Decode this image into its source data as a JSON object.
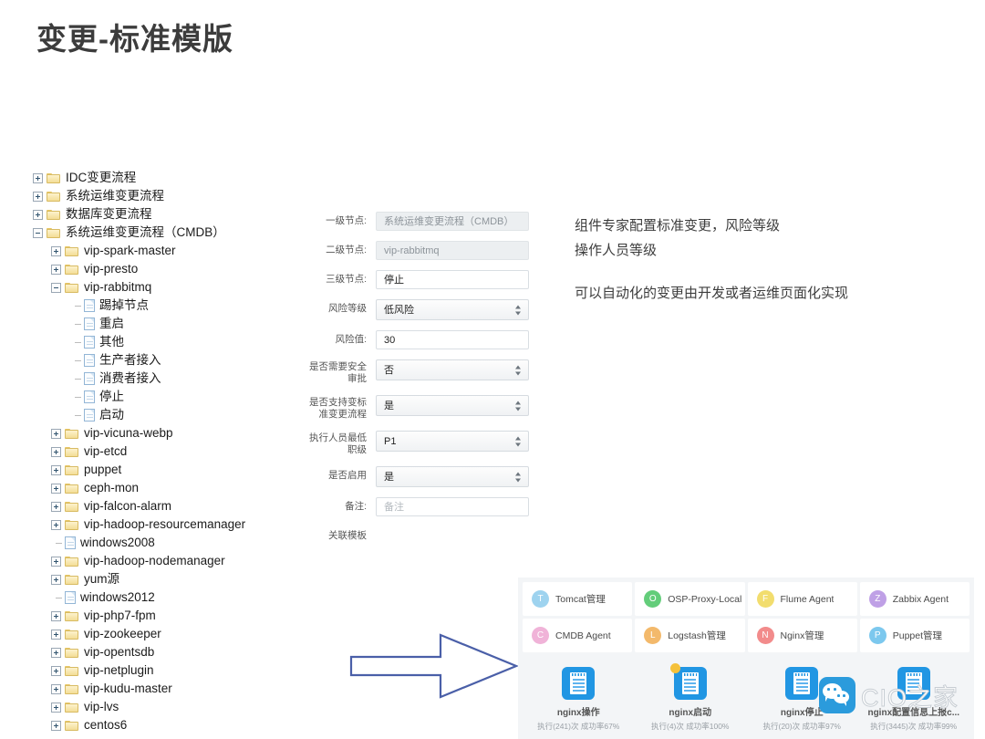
{
  "title": "变更-标准模版",
  "tree": {
    "nodes": [
      {
        "label": "IDC变更流程",
        "level": 1,
        "type": "folder",
        "state": "collapsed"
      },
      {
        "label": "系统运维变更流程",
        "level": 1,
        "type": "folder",
        "state": "collapsed"
      },
      {
        "label": "数据库变更流程",
        "level": 1,
        "type": "folder",
        "state": "collapsed"
      },
      {
        "label": "系统运维变更流程（CMDB）",
        "level": 1,
        "type": "folder",
        "state": "expanded"
      },
      {
        "label": "vip-spark-master",
        "level": 2,
        "type": "folder",
        "state": "collapsed"
      },
      {
        "label": "vip-presto",
        "level": 2,
        "type": "folder",
        "state": "collapsed"
      },
      {
        "label": "vip-rabbitmq",
        "level": 2,
        "type": "folder",
        "state": "expanded"
      },
      {
        "label": "踢掉节点",
        "level": 3,
        "type": "file",
        "state": "leaf"
      },
      {
        "label": "重启",
        "level": 3,
        "type": "file",
        "state": "leaf"
      },
      {
        "label": "其他",
        "level": 3,
        "type": "file",
        "state": "leaf"
      },
      {
        "label": "生产者接入",
        "level": 3,
        "type": "file",
        "state": "leaf"
      },
      {
        "label": "消费者接入",
        "level": 3,
        "type": "file",
        "state": "leaf"
      },
      {
        "label": "停止",
        "level": 3,
        "type": "file",
        "state": "leaf"
      },
      {
        "label": "启动",
        "level": 3,
        "type": "file",
        "state": "leaf"
      },
      {
        "label": "vip-vicuna-webp",
        "level": 2,
        "type": "folder",
        "state": "collapsed"
      },
      {
        "label": "vip-etcd",
        "level": 2,
        "type": "folder",
        "state": "collapsed"
      },
      {
        "label": "puppet",
        "level": 2,
        "type": "folder",
        "state": "collapsed"
      },
      {
        "label": "ceph-mon",
        "level": 2,
        "type": "folder",
        "state": "collapsed"
      },
      {
        "label": "vip-falcon-alarm",
        "level": 2,
        "type": "folder",
        "state": "collapsed"
      },
      {
        "label": "vip-hadoop-resourcemanager",
        "level": 2,
        "type": "folder",
        "state": "collapsed"
      },
      {
        "label": "windows2008",
        "level": 2,
        "type": "file",
        "state": "leaf"
      },
      {
        "label": "vip-hadoop-nodemanager",
        "level": 2,
        "type": "folder",
        "state": "collapsed"
      },
      {
        "label": "yum源",
        "level": 2,
        "type": "folder",
        "state": "collapsed"
      },
      {
        "label": "windows2012",
        "level": 2,
        "type": "file",
        "state": "leaf"
      },
      {
        "label": "vip-php7-fpm",
        "level": 2,
        "type": "folder",
        "state": "collapsed"
      },
      {
        "label": "vip-zookeeper",
        "level": 2,
        "type": "folder",
        "state": "collapsed"
      },
      {
        "label": "vip-opentsdb",
        "level": 2,
        "type": "folder",
        "state": "collapsed"
      },
      {
        "label": "vip-netplugin",
        "level": 2,
        "type": "folder",
        "state": "collapsed"
      },
      {
        "label": "vip-kudu-master",
        "level": 2,
        "type": "folder",
        "state": "collapsed"
      },
      {
        "label": "vip-lvs",
        "level": 2,
        "type": "folder",
        "state": "collapsed"
      },
      {
        "label": "centos6",
        "level": 2,
        "type": "folder",
        "state": "collapsed"
      }
    ]
  },
  "form": {
    "fields": [
      {
        "label": "一级节点:",
        "value": "系统运维变更流程（CMDB）",
        "control": "input",
        "disabled": true
      },
      {
        "label": "二级节点:",
        "value": "vip-rabbitmq",
        "control": "input",
        "disabled": true
      },
      {
        "label": "三级节点:",
        "value": "停止",
        "control": "input",
        "disabled": false
      },
      {
        "label": "风险等级",
        "value": "低风险",
        "control": "select"
      },
      {
        "label": "风险值:",
        "value": "30",
        "control": "input",
        "disabled": false
      },
      {
        "label": "是否需要安全审批",
        "value": "否",
        "control": "select"
      },
      {
        "label": "是否支持变标准变更流程",
        "value": "是",
        "control": "select"
      },
      {
        "label": "执行人员最低职级",
        "value": "P1",
        "control": "select"
      },
      {
        "label": "是否启用",
        "value": "是",
        "control": "select"
      },
      {
        "label": "备注:",
        "value": "",
        "placeholder": "备注",
        "control": "input",
        "disabled": false
      },
      {
        "label": "关联模板",
        "value": "",
        "control": "none"
      }
    ]
  },
  "notes": {
    "line1": "组件专家配置标准变更，风险等级",
    "line2": "操作人员等级",
    "line3": "可以自动化的变更由开发或者运维页面化实现"
  },
  "arrow": {
    "color": "#4a5fa8",
    "direction": "right"
  },
  "templates": {
    "cards": [
      {
        "initial": "T",
        "name": "Tomcat管理",
        "color": "#9ed3ef"
      },
      {
        "initial": "O",
        "name": "OSP-Proxy-Local",
        "color": "#63cd7a"
      },
      {
        "initial": "F",
        "name": "Flume Agent",
        "color": "#f2dd6e"
      },
      {
        "initial": "Z",
        "name": "Zabbix Agent",
        "color": "#bfa0e6"
      },
      {
        "initial": "C",
        "name": "CMDB Agent",
        "color": "#f0b3d8"
      },
      {
        "initial": "L",
        "name": "Logstash管理",
        "color": "#f3b96b"
      },
      {
        "initial": "N",
        "name": "Nginx管理",
        "color": "#f28b8b"
      },
      {
        "initial": "P",
        "name": "Puppet管理",
        "color": "#7cc8ee"
      }
    ]
  },
  "jobs": [
    {
      "name": "nginx操作",
      "stat": "执行(241)次 成功率67%",
      "badge": false
    },
    {
      "name": "nginx启动",
      "stat": "执行(4)次 成功率100%",
      "badge": true
    },
    {
      "name": "nginx停止",
      "stat": "执行(20)次 成功率97%",
      "badge": false
    },
    {
      "name": "nginx配置信息上报c...",
      "stat": "执行(3445)次 成功率99%",
      "badge": false
    }
  ],
  "watermark": {
    "text": "CIO之家"
  }
}
